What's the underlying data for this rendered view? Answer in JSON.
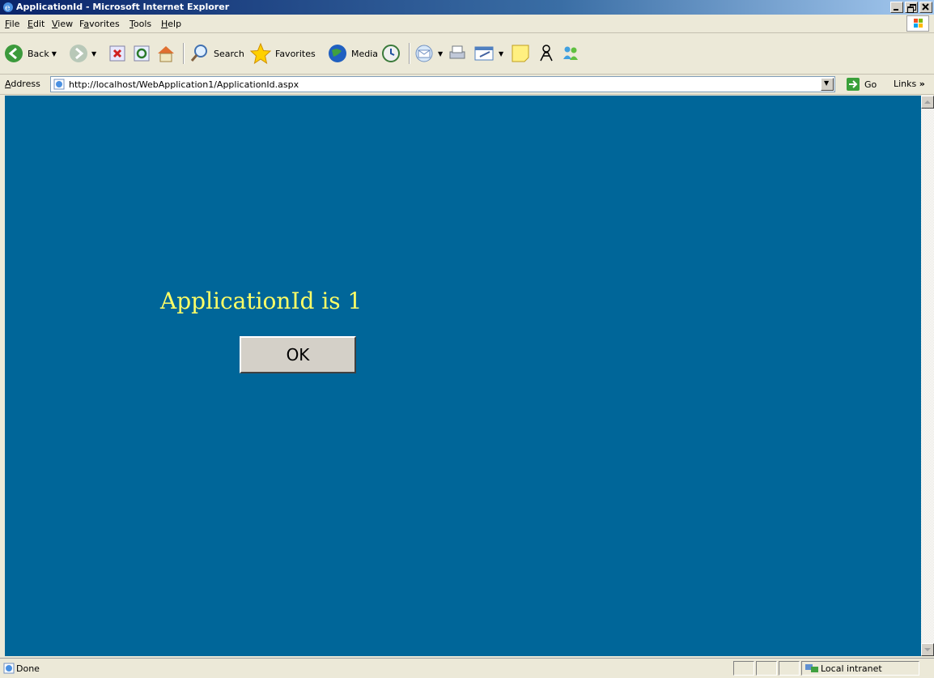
{
  "window": {
    "title": "ApplicationId - Microsoft Internet Explorer"
  },
  "menu": {
    "file": {
      "u": "F",
      "rest": "ile"
    },
    "edit": {
      "u": "E",
      "rest": "dit"
    },
    "view": {
      "u": "V",
      "rest": "iew"
    },
    "favorites": {
      "pre": "F",
      "u": "a",
      "rest": "vorites"
    },
    "tools": {
      "u": "T",
      "rest": "ools"
    },
    "help": {
      "u": "H",
      "rest": "elp"
    }
  },
  "toolbar": {
    "back": "Back",
    "search": "Search",
    "favorites": "Favorites",
    "media": "Media"
  },
  "address": {
    "label_u": "A",
    "label_rest": "ddress",
    "url": "http://localhost/WebApplication1/ApplicationId.aspx",
    "go": "Go",
    "links": "Links",
    "links_chevron": "»"
  },
  "page": {
    "message": "ApplicationId is 1",
    "ok_button": "OK"
  },
  "status": {
    "text": "Done",
    "zone": "Local intranet"
  },
  "colors": {
    "page_background": "#006699",
    "message_text": "#ffff66"
  }
}
